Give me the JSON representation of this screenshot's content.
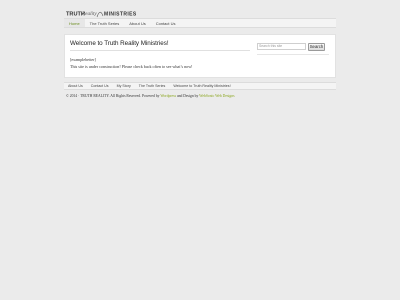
{
  "header": {
    "logo_text_left": "TRUTH",
    "logo_text_mid": "Reality",
    "logo_text_right": "MINISTRIES"
  },
  "nav": {
    "items": [
      "Home",
      "The Truth Series",
      "About Us",
      "Contact Us"
    ],
    "active_index": 0
  },
  "main": {
    "title": "Welcome to Truth Reality Ministries!",
    "shortcode": "[examplebetter]",
    "message": "This site is under construction! Please check back often to see what’s now!"
  },
  "search": {
    "placeholder": "Search this site",
    "button_label": "Search"
  },
  "footer": {
    "nav_items": [
      "About Us",
      "Contact Us",
      "My Story",
      "The Truth Series",
      "Welcome to Truth Reality Ministries!"
    ],
    "copyright_prefix": "© 2014 · TRUTH REALITY. All Rights Reserved. Powered by",
    "powered_by": "Wordpress",
    "design_prefix": "and Design by",
    "designer": "WebSonic Web Designs"
  },
  "colors": {
    "background": "#ebebeb",
    "accent_green": "#8aa61e",
    "nav_active_text": "#6a8d1e"
  }
}
